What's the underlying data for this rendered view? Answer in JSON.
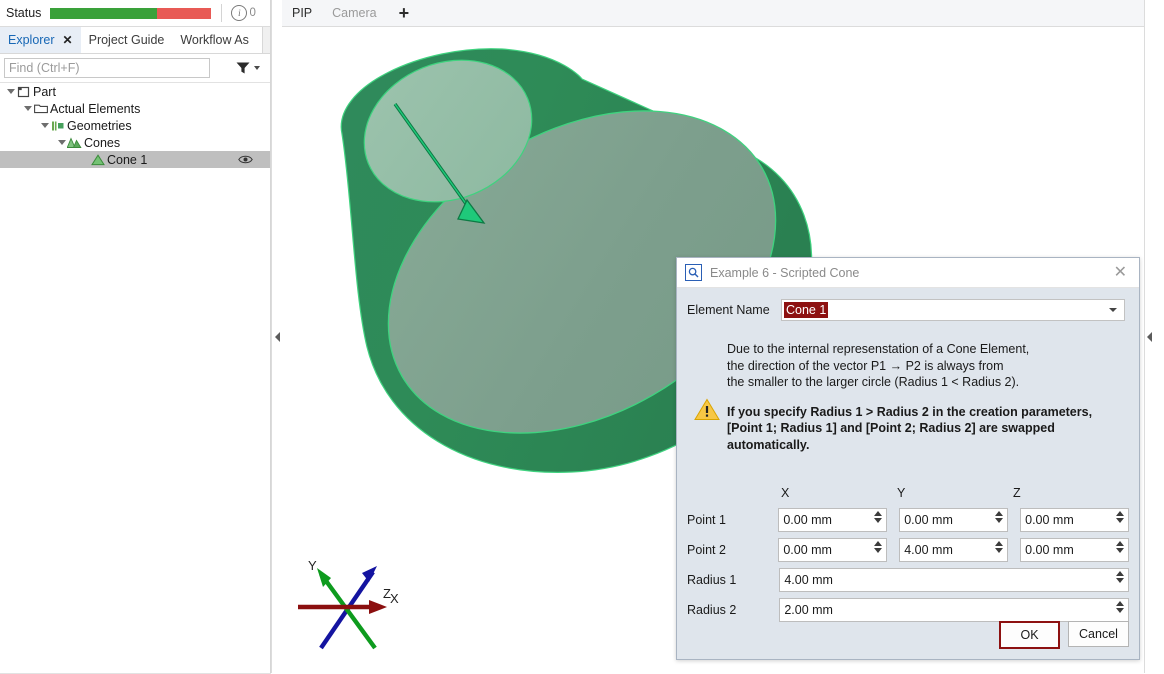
{
  "status_bar": {
    "label": "Status",
    "progress": {
      "green_percent": 66,
      "red_percent": 34,
      "green_color": "#3aa13a",
      "red_color": "#e85a55"
    },
    "info_icon": "info-circle-icon",
    "info_count": "0"
  },
  "explorer": {
    "tabs": [
      {
        "label": "Explorer",
        "active": true,
        "closable": true
      },
      {
        "label": "Project Guide",
        "active": false,
        "closable": false
      },
      {
        "label": "Workflow As",
        "active": false,
        "closable": false
      }
    ],
    "close_glyph": "✕",
    "find": {
      "placeholder": "Find (Ctrl+F)",
      "value": ""
    },
    "filter_icon": "funnel-icon",
    "filter_caret": "chevron-down-icon",
    "tree": [
      {
        "label": "Part",
        "depth": 0,
        "expanded": true,
        "icon": "part-icon",
        "selected": false
      },
      {
        "label": "Actual Elements",
        "depth": 1,
        "expanded": true,
        "icon": "folder-icon",
        "selected": false
      },
      {
        "label": "Geometries",
        "depth": 2,
        "expanded": true,
        "icon": "geometries-icon",
        "selected": false
      },
      {
        "label": "Cones",
        "depth": 3,
        "expanded": true,
        "icon": "cones-icon",
        "selected": false
      },
      {
        "label": "Cone 1",
        "depth": 4,
        "expanded": false,
        "icon": "cone-icon",
        "selected": true,
        "visibility_icon": "eye-icon"
      }
    ]
  },
  "splitters": {
    "left_arrow": "collapse-left-icon",
    "right_arrow": "collapse-left-icon"
  },
  "view": {
    "tabs": [
      {
        "label": "PIP",
        "active": true
      },
      {
        "label": "Camera",
        "active": false
      }
    ],
    "add_tab": "+",
    "model": {
      "name": "Cone 1",
      "surface_color": "#7ea191",
      "shade_color": "#2e8b57",
      "highlight_color": "#97bfa8",
      "outline_color": "#3fd37f",
      "vector_color": "#18a05a"
    },
    "axis_widget": {
      "labels": [
        "X",
        "Y",
        "Z"
      ],
      "colors": {
        "x": "#8b0f0f",
        "y": "#0e9b1e",
        "z": "#1414a0"
      }
    }
  },
  "dialog": {
    "icon": "search-box-icon",
    "title": "Example 6 - Scripted Cone",
    "close_glyph": "✕",
    "element_name": {
      "label": "Element Name",
      "value": "Cone 1",
      "selected": true,
      "selection_color": "#8d1111",
      "caret": "chevron-down-icon"
    },
    "warning": {
      "icon": "warning-triangle-icon",
      "lines": [
        "Due to the internal represenstation of a Cone Element,",
        "the direction of the vector P1 → P2 is always from",
        "the smaller to the larger circle (Radius 1 < Radius 2)."
      ],
      "bold_lines": [
        "If you specify Radius 1 > Radius 2 in the creation parameters,",
        "[Point 1; Radius 1] and [Point 2; Radius 2] are swapped",
        "automatically."
      ]
    },
    "column_headers": [
      "X",
      "Y",
      "Z"
    ],
    "fields": [
      {
        "label": "Point 1",
        "type": "triple",
        "values": [
          "0.00 mm",
          "0.00 mm",
          "0.00 mm"
        ]
      },
      {
        "label": "Point 2",
        "type": "triple",
        "values": [
          "0.00 mm",
          "4.00 mm",
          "0.00 mm"
        ]
      },
      {
        "label": "Radius 1",
        "type": "single",
        "values": [
          "4.00 mm"
        ]
      },
      {
        "label": "Radius 2",
        "type": "single",
        "values": [
          "2.00 mm"
        ]
      }
    ],
    "buttons": [
      {
        "label": "OK",
        "primary": true
      },
      {
        "label": "Cancel",
        "primary": false
      }
    ]
  }
}
